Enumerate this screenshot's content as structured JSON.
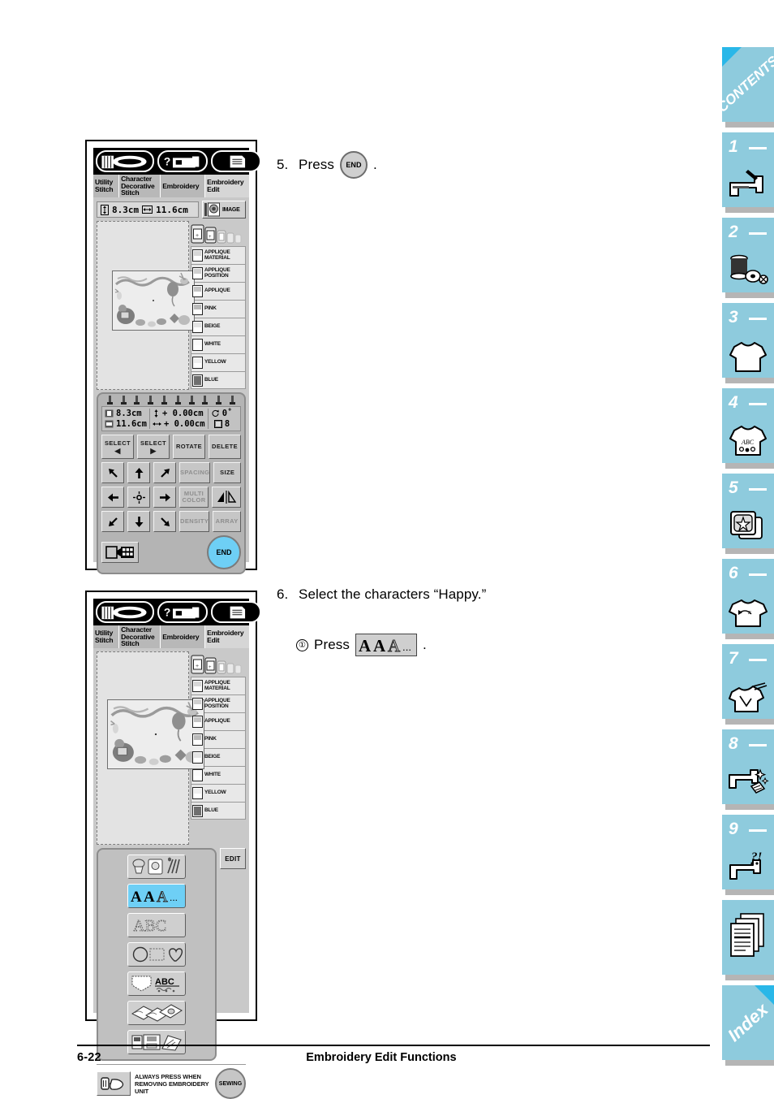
{
  "footer": {
    "page_number": "6-22",
    "title": "Embroidery Edit Functions"
  },
  "instructions": {
    "step5": {
      "number": "5.",
      "text": "Press",
      "button_label": "END",
      "trailing": "."
    },
    "step6": {
      "number": "6.",
      "text": "Select the characters “Happy.”"
    },
    "step6_sub1": {
      "marker": "①",
      "text": "Press",
      "button_label": "AAA",
      "trailing": "."
    }
  },
  "screen1": {
    "tabs": [
      {
        "label": "Utility\nStitch",
        "active": false
      },
      {
        "label": "Character\nDecorative\nStitch",
        "active": false
      },
      {
        "label": "Embroidery",
        "active": false
      },
      {
        "label": "Embroidery\nEdit",
        "active": true
      }
    ],
    "top_icons": [
      "bobbin-winder-icon",
      "help-machine-icon",
      "document-list-icon"
    ],
    "size_display": {
      "height_label": "8.3cm",
      "width_label": "11.6cm"
    },
    "image_button": "IMAGE",
    "color_list": [
      {
        "name": "APPLIQUE\nMATERIAL",
        "color": "#d8d8d8"
      },
      {
        "name": "APPLIQUE\nPOSITION",
        "color": "#d0d0d0"
      },
      {
        "name": "APPLIQUE",
        "color": "#c4c4c4"
      },
      {
        "name": "PINK",
        "color": "#b9b9b9"
      },
      {
        "name": "BEIGE",
        "color": "#e4e4e4"
      },
      {
        "name": "WHITE",
        "color": "#fbfbfb"
      },
      {
        "name": "YELLOW",
        "color": "#efefef"
      },
      {
        "name": "BLUE",
        "color": "#6f6f6f"
      }
    ],
    "readout": {
      "size_h": "8.3cm",
      "size_w": "11.6cm",
      "offset_v": "+ 0.00cm",
      "offset_h": "+ 0.00cm",
      "rotation": "0˚",
      "count": "8"
    },
    "buttons": {
      "select_prev": "SELECT",
      "select_next": "SELECT",
      "rotate": "ROTATE",
      "delete": "DELETE",
      "spacing": "SPACING",
      "size": "SIZE",
      "multi_color": "MULTI\nCOLOR",
      "mirror": "mirror-icon",
      "density": "DENSITY",
      "array": "ARRAY",
      "hoop_layout": "hoop-layout-icon",
      "end": "END"
    }
  },
  "screen2": {
    "tabs": [
      {
        "label": "Utility\nStitch",
        "active": false
      },
      {
        "label": "Character\nDecorative\nStitch",
        "active": false
      },
      {
        "label": "Embroidery",
        "active": false
      },
      {
        "label": "Embroidery\nEdit",
        "active": true
      }
    ],
    "color_list": [
      {
        "name": "APPLIQUE\nMATERIAL",
        "color": "#d8d8d8"
      },
      {
        "name": "APPLIQUE\nPOSITION",
        "color": "#d0d0d0"
      },
      {
        "name": "APPLIQUE",
        "color": "#c4c4c4"
      },
      {
        "name": "PINK",
        "color": "#b9b9b9"
      },
      {
        "name": "BEIGE",
        "color": "#e4e4e4"
      },
      {
        "name": "WHITE",
        "color": "#fbfbfb"
      },
      {
        "name": "YELLOW",
        "color": "#efefef"
      },
      {
        "name": "BLUE",
        "color": "#6f6f6f"
      }
    ],
    "categories": [
      {
        "name": "embroidery-patterns-icon",
        "highlighted": false
      },
      {
        "name": "character-fonts-icon",
        "highlighted": true
      },
      {
        "name": "alphabet-abc-icon",
        "highlighted": false
      },
      {
        "name": "frame-shapes-icon",
        "highlighted": false
      },
      {
        "name": "pocket-abc-icon",
        "highlighted": false
      },
      {
        "name": "card-patterns-icon",
        "highlighted": false
      },
      {
        "name": "memory-card-icon",
        "highlighted": false
      }
    ],
    "edit_button": "EDIT",
    "footer_note": "ALWAYS PRESS WHEN\nREMOVING EMBROIDERY\nUNIT",
    "sewing_button": "SEWING"
  },
  "sidebar": {
    "contents_label": "CONTENTS",
    "index_label": "Index",
    "tabs": [
      {
        "number": "1",
        "icon": "sewing-machine-needle-icon"
      },
      {
        "number": "2",
        "icon": "thread-spools-icon"
      },
      {
        "number": "3",
        "icon": "tshirt-icon"
      },
      {
        "number": "4",
        "icon": "tshirt-abc-icon"
      },
      {
        "number": "5",
        "icon": "frame-star-icon"
      },
      {
        "number": "6",
        "icon": "tshirt-decorative-icon"
      },
      {
        "number": "7",
        "icon": "tshirt-needle-icon"
      },
      {
        "number": "8",
        "icon": "machine-sparkle-icon"
      },
      {
        "number": "9",
        "icon": "machine-question-icon"
      }
    ],
    "appendix_icon": "documents-icon"
  },
  "colors": {
    "tab_blue": "#8ecbdd",
    "accent_cyan": "#29b7e8",
    "highlight": "#6ecff5"
  }
}
